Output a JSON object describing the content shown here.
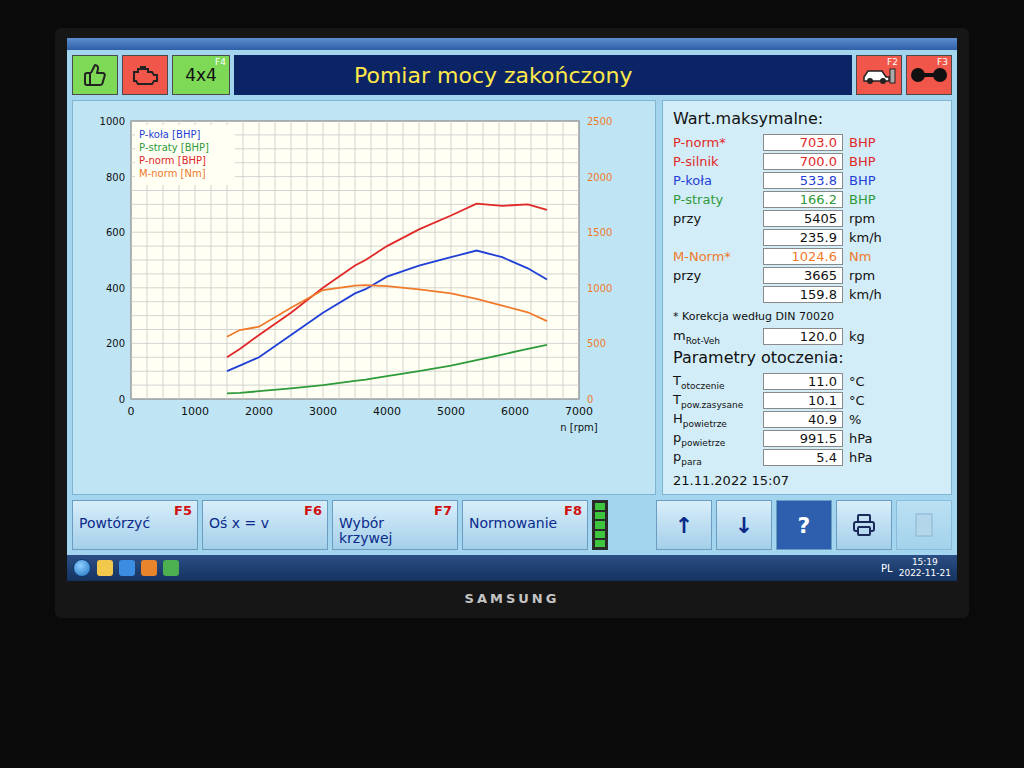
{
  "window": {
    "title": "Pomiar mocy zakończony"
  },
  "toolbar": {
    "left": [
      {
        "kind": "thumbs",
        "key": "",
        "label": "",
        "color": "#7ed957"
      },
      {
        "kind": "engine",
        "key": "",
        "label": "",
        "color": "#f0564a"
      },
      {
        "kind": "text",
        "key": "F4",
        "label": "4x4",
        "color": "#7ed957"
      }
    ],
    "right": [
      {
        "kind": "car",
        "key": "F2",
        "label": "",
        "color": "#f0564a"
      },
      {
        "kind": "wheels",
        "key": "F3",
        "label": "",
        "color": "#f0564a"
      }
    ]
  },
  "chart": {
    "legend": [
      {
        "label": "P-koła [BHP]",
        "color": "#1f3fd6"
      },
      {
        "label": "P-straty [BHP]",
        "color": "#2e9a3a"
      },
      {
        "label": "P-norm [BHP]",
        "color": "#e02828"
      },
      {
        "label": "M-norm [Nm]",
        "color": "#f07a2a"
      }
    ],
    "y_ticks": [
      "0",
      "200",
      "400",
      "600",
      "800",
      "1000"
    ],
    "y2_ticks": [
      "0",
      "500",
      "1000",
      "1500",
      "2000",
      "2500"
    ],
    "x_ticks": [
      "0",
      "1000",
      "2000",
      "3000",
      "4000",
      "5000",
      "6000",
      "7000"
    ],
    "x_label": "n [rpm]",
    "rpm": [
      1500,
      1700,
      2000,
      2500,
      3000,
      3500,
      3665,
      4000,
      4500,
      5000,
      5400,
      5800,
      6200,
      6500
    ],
    "series": [
      {
        "name": "P-koła [BHP]",
        "color": "#1f3fd6",
        "axis": "left",
        "values": [
          100,
          120,
          150,
          230,
          310,
          380,
          395,
          440,
          480,
          510,
          534,
          510,
          470,
          430
        ]
      },
      {
        "name": "P-straty [BHP]",
        "color": "#2e9a3a",
        "axis": "left",
        "values": [
          20,
          22,
          28,
          38,
          50,
          65,
          70,
          82,
          100,
          120,
          140,
          160,
          180,
          195
        ]
      },
      {
        "name": "P-norm [BHP]",
        "color": "#e02828",
        "axis": "left",
        "values": [
          150,
          180,
          230,
          310,
          400,
          480,
          500,
          550,
          610,
          660,
          703,
          695,
          700,
          680
        ]
      },
      {
        "name": "M-norm [Nm]",
        "color": "#f07a2a",
        "axis": "right",
        "values": [
          560,
          620,
          650,
          820,
          980,
          1020,
          1024.6,
          1015,
          985,
          950,
          900,
          840,
          780,
          700
        ]
      }
    ]
  },
  "maxima": {
    "title": "Wart.maksymalne:",
    "rows": [
      {
        "label": "P-norm*",
        "value": "703.0",
        "unit": "BHP",
        "color": "#e02828"
      },
      {
        "label": "P-silnik",
        "value": "700.0",
        "unit": "BHP",
        "color": "#e02828"
      },
      {
        "label": "P-koła",
        "value": "533.8",
        "unit": "BHP",
        "color": "#1f3fd6"
      },
      {
        "label": "P-straty",
        "value": "166.2",
        "unit": "BHP",
        "color": "#2e9a3a"
      },
      {
        "label": "przy",
        "value": "5405",
        "unit": "rpm",
        "color": "#111111"
      },
      {
        "label": "",
        "value": "235.9",
        "unit": "km/h",
        "color": "#111111"
      },
      {
        "label": "M-Norm*",
        "value": "1024.6",
        "unit": "Nm",
        "color": "#f07a2a"
      },
      {
        "label": "przy",
        "value": "3665",
        "unit": "rpm",
        "color": "#111111"
      },
      {
        "label": "",
        "value": "159.8",
        "unit": "km/h",
        "color": "#111111"
      }
    ],
    "note": "* Korekcja według DIN 70020",
    "mass": {
      "label": "m",
      "sub": "Rot-Veh",
      "value": "120.0",
      "unit": "kg"
    }
  },
  "environment": {
    "title": "Parametry otoczenia:",
    "rows": [
      {
        "label": "T",
        "sub": "otoczenie",
        "value": "11.0",
        "unit": "°C"
      },
      {
        "label": "T",
        "sub": "pow.zasysane",
        "value": "10.1",
        "unit": "°C"
      },
      {
        "label": "H",
        "sub": "powietrze",
        "value": "40.9",
        "unit": "%"
      },
      {
        "label": "p",
        "sub": "powietrze",
        "value": "991.5",
        "unit": "hPa"
      },
      {
        "label": "p",
        "sub": "para",
        "value": "5.4",
        "unit": "hPa"
      }
    ]
  },
  "timestamp": "21.11.2022 15:07",
  "function_keys": [
    {
      "label": "Powtórzyć",
      "key": "F5"
    },
    {
      "label": "Oś x = v",
      "key": "F6"
    },
    {
      "label": "Wybór krzywej",
      "key": "F7"
    },
    {
      "label": "Normowanie",
      "key": "F8"
    }
  ],
  "indicator": {
    "level": 1
  },
  "nav_buttons": [
    {
      "kind": "up",
      "label": "↑",
      "disabled": false
    },
    {
      "kind": "down",
      "label": "↓",
      "disabled": false
    },
    {
      "kind": "help",
      "label": "?",
      "disabled": false
    },
    {
      "kind": "print",
      "label": "",
      "disabled": false
    },
    {
      "kind": "exit",
      "label": "",
      "disabled": true
    }
  ],
  "taskbar": {
    "language": "PL",
    "time": "15:19",
    "date": "2022-11-21"
  },
  "monitor": {
    "brand": "SAMSUNG"
  }
}
